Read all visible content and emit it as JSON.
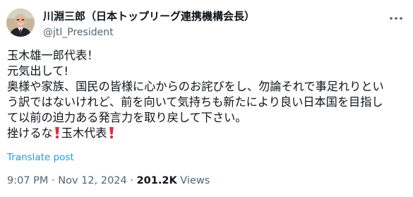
{
  "author": {
    "display_name": "川淵三郎（日本トップリーグ連携機構会長）",
    "handle": "@jtl_President"
  },
  "tweet": {
    "lines": [
      "玉木雄一郎代表！",
      "元気出して!",
      "奥様や家族、国民の皆様に心からのお詫びをし、勿論それで事足れりとい",
      "う訳ではないけれど、前を向いて気持ちも新たにより良い日本国を目指し",
      "て以前の迫力ある発言力を取り戻して下さい。"
    ],
    "last_line_before": "挫けるな",
    "last_line_after": "玉木代表",
    "emoji_icon": "red-exclamation-mark-icon"
  },
  "translate_label": "Translate post",
  "meta": {
    "time": "9:07 PM",
    "separator": "·",
    "date": "Nov 12, 2024",
    "views_count": "201.2K",
    "views_label": "Views"
  },
  "colors": {
    "text": "#0f1419",
    "secondary": "#536471",
    "link": "#1d9bf0",
    "emoji_red": "#dd2e44"
  }
}
